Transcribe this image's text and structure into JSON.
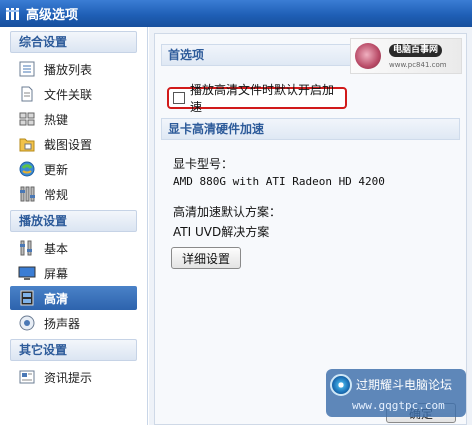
{
  "window": {
    "title": "高级选项"
  },
  "sidebar": {
    "sections": [
      {
        "title": "综合设置",
        "items": [
          {
            "label": "播放列表",
            "icon": "playlist-icon"
          },
          {
            "label": "文件关联",
            "icon": "file-association-icon"
          },
          {
            "label": "热键",
            "icon": "hotkey-icon"
          },
          {
            "label": "截图设置",
            "icon": "screenshot-icon"
          },
          {
            "label": "更新",
            "icon": "update-icon"
          },
          {
            "label": "常规",
            "icon": "general-icon"
          }
        ]
      },
      {
        "title": "播放设置",
        "items": [
          {
            "label": "基本",
            "icon": "basic-icon"
          },
          {
            "label": "屏幕",
            "icon": "screen-icon"
          },
          {
            "label": "高清",
            "icon": "hd-icon",
            "active": true
          },
          {
            "label": "扬声器",
            "icon": "speaker-icon"
          }
        ]
      },
      {
        "title": "其它设置",
        "items": [
          {
            "label": "资讯提示",
            "icon": "news-icon"
          }
        ]
      }
    ]
  },
  "content": {
    "preferences_title": "首选项",
    "checkbox": {
      "label": "播放高清文件时默认开启加速",
      "checked": false
    },
    "hw_section_title": "显卡高清硬件加速",
    "gpu_label": "显卡型号：",
    "gpu_value": "AMD 880G with ATI Radeon HD 4200",
    "scheme_label": "高清加速默认方案：",
    "scheme_value": "ATI UVD解决方案",
    "details_button": "详细设置",
    "banner": {
      "title": "电脑百事网",
      "url": "www.pc841.com"
    }
  },
  "footer": {
    "ok_button": "确定",
    "watermark": {
      "title": "过期耀斗电脑论坛",
      "url": "www.gqgtpc.com"
    }
  },
  "colors": {
    "accent": "#2d63ad",
    "highlight_border": "#d11a1a",
    "section_text": "#2d5b9a"
  }
}
